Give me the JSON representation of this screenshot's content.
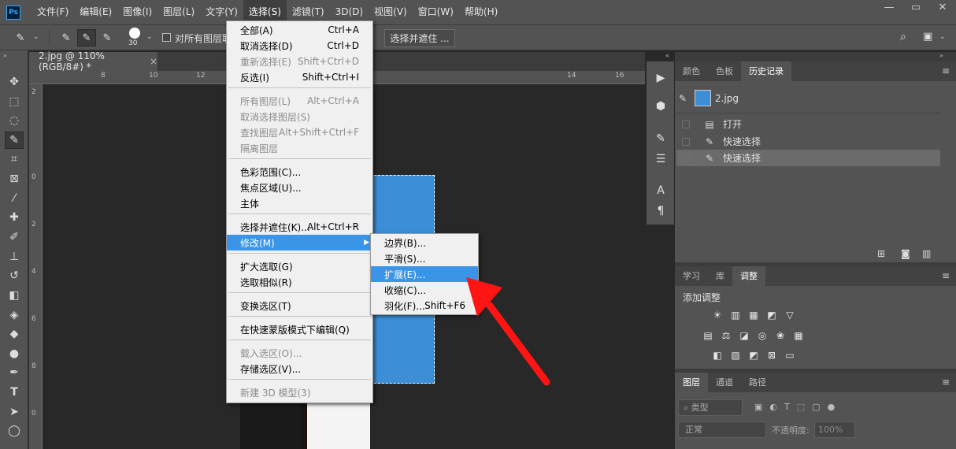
{
  "app": {
    "logo": "Ps"
  },
  "menubar": {
    "items": [
      "文件(F)",
      "编辑(E)",
      "图像(I)",
      "图层(L)",
      "文字(Y)",
      "选择(S)",
      "滤镜(T)",
      "3D(D)",
      "视图(V)",
      "窗口(W)",
      "帮助(H)"
    ],
    "active": "选择(S)"
  },
  "window_controls": {
    "minimize": "—",
    "restore": "▭",
    "close": "✕"
  },
  "options": {
    "brush_size": "30",
    "sample_all_layers": "对所有图层取",
    "select_mask": "选择并遮住 ..."
  },
  "document": {
    "tab": "2.jpg @ 110%(RGB/8#) *",
    "close": "×"
  },
  "ruler": {
    "h": [
      "8",
      "10",
      "12",
      "14",
      "16"
    ],
    "v": [
      "2",
      "0",
      "2",
      "4",
      "6",
      "8",
      "0"
    ]
  },
  "select_menu": {
    "items": [
      {
        "label": "全部(A)",
        "shortcut": "Ctrl+A"
      },
      {
        "label": "取消选择(D)",
        "shortcut": "Ctrl+D"
      },
      {
        "label": "重新选择(E)",
        "shortcut": "Shift+Ctrl+D"
      },
      {
        "label": "反选(I)",
        "shortcut": "Shift+Ctrl+I"
      },
      {
        "label": "所有图层(L)",
        "shortcut": "Alt+Ctrl+A"
      },
      {
        "label": "取消选择图层(S)",
        "shortcut": ""
      },
      {
        "label": "查找图层",
        "shortcut": "Alt+Shift+Ctrl+F"
      },
      {
        "label": "隔离图层",
        "shortcut": ""
      },
      {
        "label": "色彩范围(C)...",
        "shortcut": ""
      },
      {
        "label": "焦点区域(U)...",
        "shortcut": ""
      },
      {
        "label": "主体",
        "shortcut": ""
      },
      {
        "label": "选择并遮住(K)...",
        "shortcut": "Alt+Ctrl+R"
      },
      {
        "label": "修改(M)",
        "shortcut": "▶"
      },
      {
        "label": "扩大选取(G)",
        "shortcut": ""
      },
      {
        "label": "选取相似(R)",
        "shortcut": ""
      },
      {
        "label": "变换选区(T)",
        "shortcut": ""
      },
      {
        "label": "在快速蒙版模式下编辑(Q)",
        "shortcut": ""
      },
      {
        "label": "载入选区(O)...",
        "shortcut": ""
      },
      {
        "label": "存储选区(V)...",
        "shortcut": ""
      },
      {
        "label": "新建 3D 模型(3)",
        "shortcut": ""
      }
    ]
  },
  "modify_submenu": {
    "items": [
      {
        "label": "边界(B)...",
        "shortcut": ""
      },
      {
        "label": "平滑(S)...",
        "shortcut": ""
      },
      {
        "label": "扩展(E)...",
        "shortcut": ""
      },
      {
        "label": "收缩(C)...",
        "shortcut": ""
      },
      {
        "label": "羽化(F)...",
        "shortcut": "Shift+F6"
      }
    ]
  },
  "panel_top": {
    "tabs": [
      "颜色",
      "色板",
      "历史记录"
    ],
    "active": "历史记录"
  },
  "history": {
    "snapshot": "2.jpg",
    "rows": [
      "打开",
      "快速选择",
      "快速选择"
    ]
  },
  "panel_mid": {
    "tabs": [
      "学习",
      "库",
      "调整"
    ],
    "active": "调整",
    "title": "添加调整"
  },
  "panel_bottom": {
    "tabs": [
      "图层",
      "通道",
      "路径"
    ],
    "active": "图层",
    "filter": "类型",
    "blend": "正常",
    "opacity_label": "不透明度:",
    "opacity": "100%"
  },
  "colors": {
    "accent": "#3a95e8",
    "arrow": "#ff1414",
    "selection_blue": "#3c8fd6"
  }
}
